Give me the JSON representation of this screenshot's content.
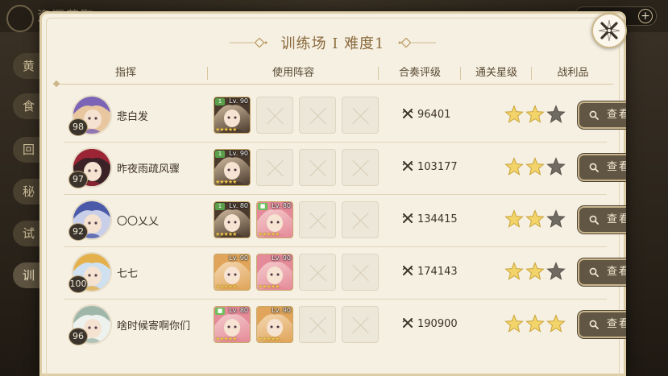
{
  "background": {
    "header_title": "资源获取",
    "side_tabs": [
      "黄",
      "食",
      "回",
      "秘",
      "试",
      "训"
    ],
    "active_tab_index": 5
  },
  "dialog": {
    "title": "训练场 I  难度1",
    "close_icon": "close-cross-icon",
    "columns": {
      "commander": "指挥",
      "lineup": "使用阵容",
      "score": "合奏评级",
      "stars": "通关星级",
      "loot": "战利品"
    },
    "view_label": "查看",
    "rows": [
      {
        "name": "悲白发",
        "level": "98",
        "score": "96401",
        "stars": 2,
        "avatar_colors": [
          "#7b63b6",
          "#e8c7a0"
        ],
        "slots": [
          {
            "type": "char",
            "lv": "Lv. 90",
            "tag": "1",
            "tag_color": "#5aa04a",
            "colors": [
              "#4a3a2e",
              "#e9d2b3"
            ],
            "stars": "★★★★★"
          },
          {
            "type": "empty"
          },
          {
            "type": "empty"
          },
          {
            "type": "empty"
          }
        ]
      },
      {
        "name": "昨夜雨疏风骤",
        "level": "97",
        "score": "103177",
        "stars": 2,
        "avatar_colors": [
          "#9b2435",
          "#3a2226"
        ],
        "slots": [
          {
            "type": "char",
            "lv": "Lv. 90",
            "tag": "1",
            "tag_color": "#5aa04a",
            "colors": [
              "#4a3a2e",
              "#e9d2b3"
            ],
            "stars": "★★★★★"
          },
          {
            "type": "empty"
          },
          {
            "type": "empty"
          },
          {
            "type": "empty"
          }
        ]
      },
      {
        "name": "〇〇乂乂",
        "level": "92",
        "score": "134415",
        "stars": 2,
        "avatar_colors": [
          "#4b5aa8",
          "#c9cfe8"
        ],
        "slots": [
          {
            "type": "char",
            "lv": "Lv. 80",
            "tag": "1",
            "tag_color": "#5aa04a",
            "colors": [
              "#4a3a2e",
              "#e9d2b3"
            ],
            "stars": "★★★★★"
          },
          {
            "type": "char",
            "lv": "Lv. 80",
            "tag": "■",
            "tag_color": "#6cbf5a",
            "colors": [
              "#e58a98",
              "#f6d7d6"
            ],
            "stars": "★★★★★"
          },
          {
            "type": "empty"
          },
          {
            "type": "empty"
          }
        ]
      },
      {
        "name": "七七",
        "level": "100",
        "score": "174143",
        "stars": 2,
        "avatar_colors": [
          "#e3b04c",
          "#cfe0f1"
        ],
        "slots": [
          {
            "type": "char",
            "lv": "Lv. 90",
            "tag": "",
            "tag_color": "",
            "colors": [
              "#e0a55a",
              "#f7e1c2"
            ],
            "stars": "★★★★★"
          },
          {
            "type": "char",
            "lv": "Lv. 90",
            "tag": "",
            "tag_color": "",
            "colors": [
              "#e58a98",
              "#f6d7d6"
            ],
            "stars": "★★★★★"
          },
          {
            "type": "empty"
          },
          {
            "type": "empty"
          }
        ]
      },
      {
        "name": "啥时候寄啊你们",
        "level": "96",
        "score": "190900",
        "stars": 3,
        "avatar_colors": [
          "#9fb7a8",
          "#eef2ef"
        ],
        "slots": [
          {
            "type": "char",
            "lv": "Lv. 80",
            "tag": "■",
            "tag_color": "#6cbf5a",
            "colors": [
              "#e58a98",
              "#f6d7d6"
            ],
            "stars": "★★★★★"
          },
          {
            "type": "char",
            "lv": "Lv. 90",
            "tag": "",
            "tag_color": "",
            "colors": [
              "#e0a55a",
              "#f7e1c2"
            ],
            "stars": "★★★★★"
          },
          {
            "type": "empty"
          },
          {
            "type": "empty"
          }
        ]
      }
    ]
  },
  "colors": {
    "panel_bg": "#f6f0e2",
    "title": "#8a6a3e",
    "star_filled": "#f2d46a",
    "star_empty": "#6f6a62",
    "button_bg": "#615543"
  }
}
